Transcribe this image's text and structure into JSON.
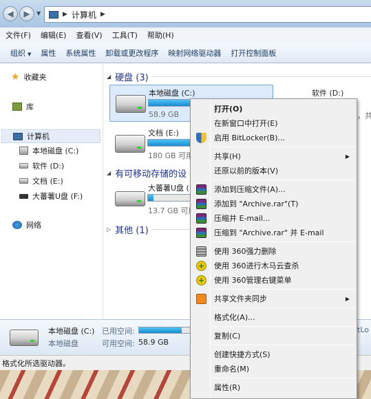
{
  "window": {
    "breadcrumb": "计算机"
  },
  "menubar": {
    "items": [
      "文件(F)",
      "编辑(E)",
      "查看(V)",
      "工具(T)",
      "帮助(H)"
    ]
  },
  "toolbar": {
    "items": [
      "组织",
      "属性",
      "系统属性",
      "卸载或更改程序",
      "映射网络驱动器",
      "打开控制面板"
    ]
  },
  "navpane": {
    "favorites": "收藏夹",
    "libraries": "库",
    "computer": "计算机",
    "drives": [
      "本地磁盘 (C:)",
      "软件 (D:)",
      "文档 (E:)",
      "大蕃薯U盘 (F:)"
    ],
    "network": "网络"
  },
  "content": {
    "group_hdd": "硬盘 (3)",
    "group_removable": "有可移动存储的设",
    "group_other": "其他 (1)",
    "drives": [
      {
        "name": "本地磁盘 (C:)",
        "size": "58.9 GB",
        "used_fraction": 0.8
      },
      {
        "name": "文档 (E:)",
        "size": "180 GB 可用",
        "used_fraction": 0.85
      },
      {
        "name": "大蕃薯U盘 (F:)",
        "size": "13.7 GB 可用",
        "used_fraction": 0.05
      }
    ],
    "drive_d_name": "软件 (D:)",
    "drive_d_clip": "，共"
  },
  "details": {
    "name": "本地磁盘 (C:)",
    "type": "本地磁盘",
    "used_label": "已用空间:",
    "free_label": "可用空间:",
    "free_value": "58.9 GB",
    "clip_text": "tLo",
    "used_fraction": 0.8
  },
  "statusbar": {
    "text": "格式化所选驱动器。"
  },
  "context_menu": {
    "items": [
      {
        "label": "打开(O)",
        "bold": true
      },
      {
        "label": "在新窗口中打开(E)"
      },
      {
        "label": "启用 BitLocker(B)...",
        "icon": "shield-icon"
      },
      {
        "separator": true
      },
      {
        "label": "共享(H)",
        "submenu": true
      },
      {
        "label": "还原以前的版本(V)"
      },
      {
        "separator": true
      },
      {
        "label": "添加到压缩文件(A)...",
        "icon": "winrar-icon"
      },
      {
        "label": "添加到 \"Archive.rar\"(T)",
        "icon": "winrar-icon"
      },
      {
        "label": "压缩并 E-mail...",
        "icon": "winrar-icon"
      },
      {
        "label": "压缩到 \"Archive.rar\" 并 E-mail",
        "icon": "winrar-icon"
      },
      {
        "separator": true
      },
      {
        "label": "使用 360强力删除",
        "icon": "shredder-icon"
      },
      {
        "label": "使用 360进行木马云查杀",
        "icon": "360-icon"
      },
      {
        "label": "使用 360管理右键菜单",
        "icon": "360-icon"
      },
      {
        "separator": true
      },
      {
        "label": "共享文件夹同步",
        "icon": "sync-icon",
        "submenu": true
      },
      {
        "separator": true
      },
      {
        "label": "格式化(A)..."
      },
      {
        "separator": true
      },
      {
        "label": "复制(C)"
      },
      {
        "separator": true
      },
      {
        "label": "创建快捷方式(S)"
      },
      {
        "label": "重命名(M)"
      },
      {
        "separator": true
      },
      {
        "label": "属性(R)"
      }
    ]
  }
}
